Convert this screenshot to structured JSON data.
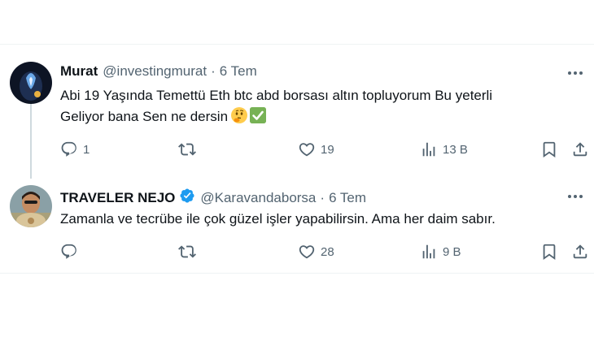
{
  "tweets": [
    {
      "name": "Murat",
      "handle": "@investingmurat",
      "separator": "·",
      "date": "6 Tem",
      "verified": false,
      "text_line1": "Abi 19 Yaşında Temettü Eth btc abd borsası altın topluyorum Bu yeterli",
      "text_line2": "Geliyor bana Sen ne dersin",
      "emojis": [
        "thinking-face",
        "check-mark"
      ],
      "replies": "1",
      "retweets": "",
      "likes": "19",
      "views": "13 B"
    },
    {
      "name": "TRAVELER NEJO",
      "handle": "@Karavandaborsa",
      "separator": "·",
      "date": "6 Tem",
      "verified": true,
      "text_line1": "Zamanla ve tecrübe ile çok güzel işler yapabilirsin. Ama her daim sabır.",
      "replies": "",
      "retweets": "",
      "likes": "28",
      "views": "9 B"
    }
  ],
  "colors": {
    "accent": "#1d9bf0",
    "text": "#0f1419",
    "secondary": "#536471",
    "divider": "#eff3f4"
  }
}
